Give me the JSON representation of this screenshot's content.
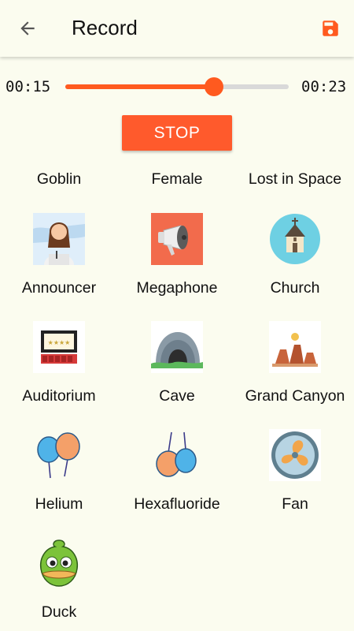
{
  "header": {
    "title": "Record",
    "back_icon": "arrow-left-icon",
    "save_icon": "floppy-disk-icon",
    "accent": "#ff5a1f"
  },
  "player": {
    "current_time": "00:15",
    "total_time": "00:23",
    "progress": 0.665,
    "stop_label": "STOP"
  },
  "effects": [
    {
      "label": "Goblin",
      "icon": ""
    },
    {
      "label": "Female",
      "icon": ""
    },
    {
      "label": "Lost in Space",
      "icon": ""
    },
    {
      "label": "Announcer",
      "icon": "announcer-icon"
    },
    {
      "label": "Megaphone",
      "icon": "megaphone-icon"
    },
    {
      "label": "Church",
      "icon": "church-icon"
    },
    {
      "label": "Auditorium",
      "icon": "auditorium-icon"
    },
    {
      "label": "Cave",
      "icon": "cave-icon"
    },
    {
      "label": "Grand Canyon",
      "icon": "grand-canyon-icon"
    },
    {
      "label": "Helium",
      "icon": "helium-balloons-icon"
    },
    {
      "label": "Hexafluoride",
      "icon": "hexafluoride-balloons-icon"
    },
    {
      "label": "Fan",
      "icon": "fan-icon"
    },
    {
      "label": "Duck",
      "icon": "duck-icon"
    }
  ]
}
